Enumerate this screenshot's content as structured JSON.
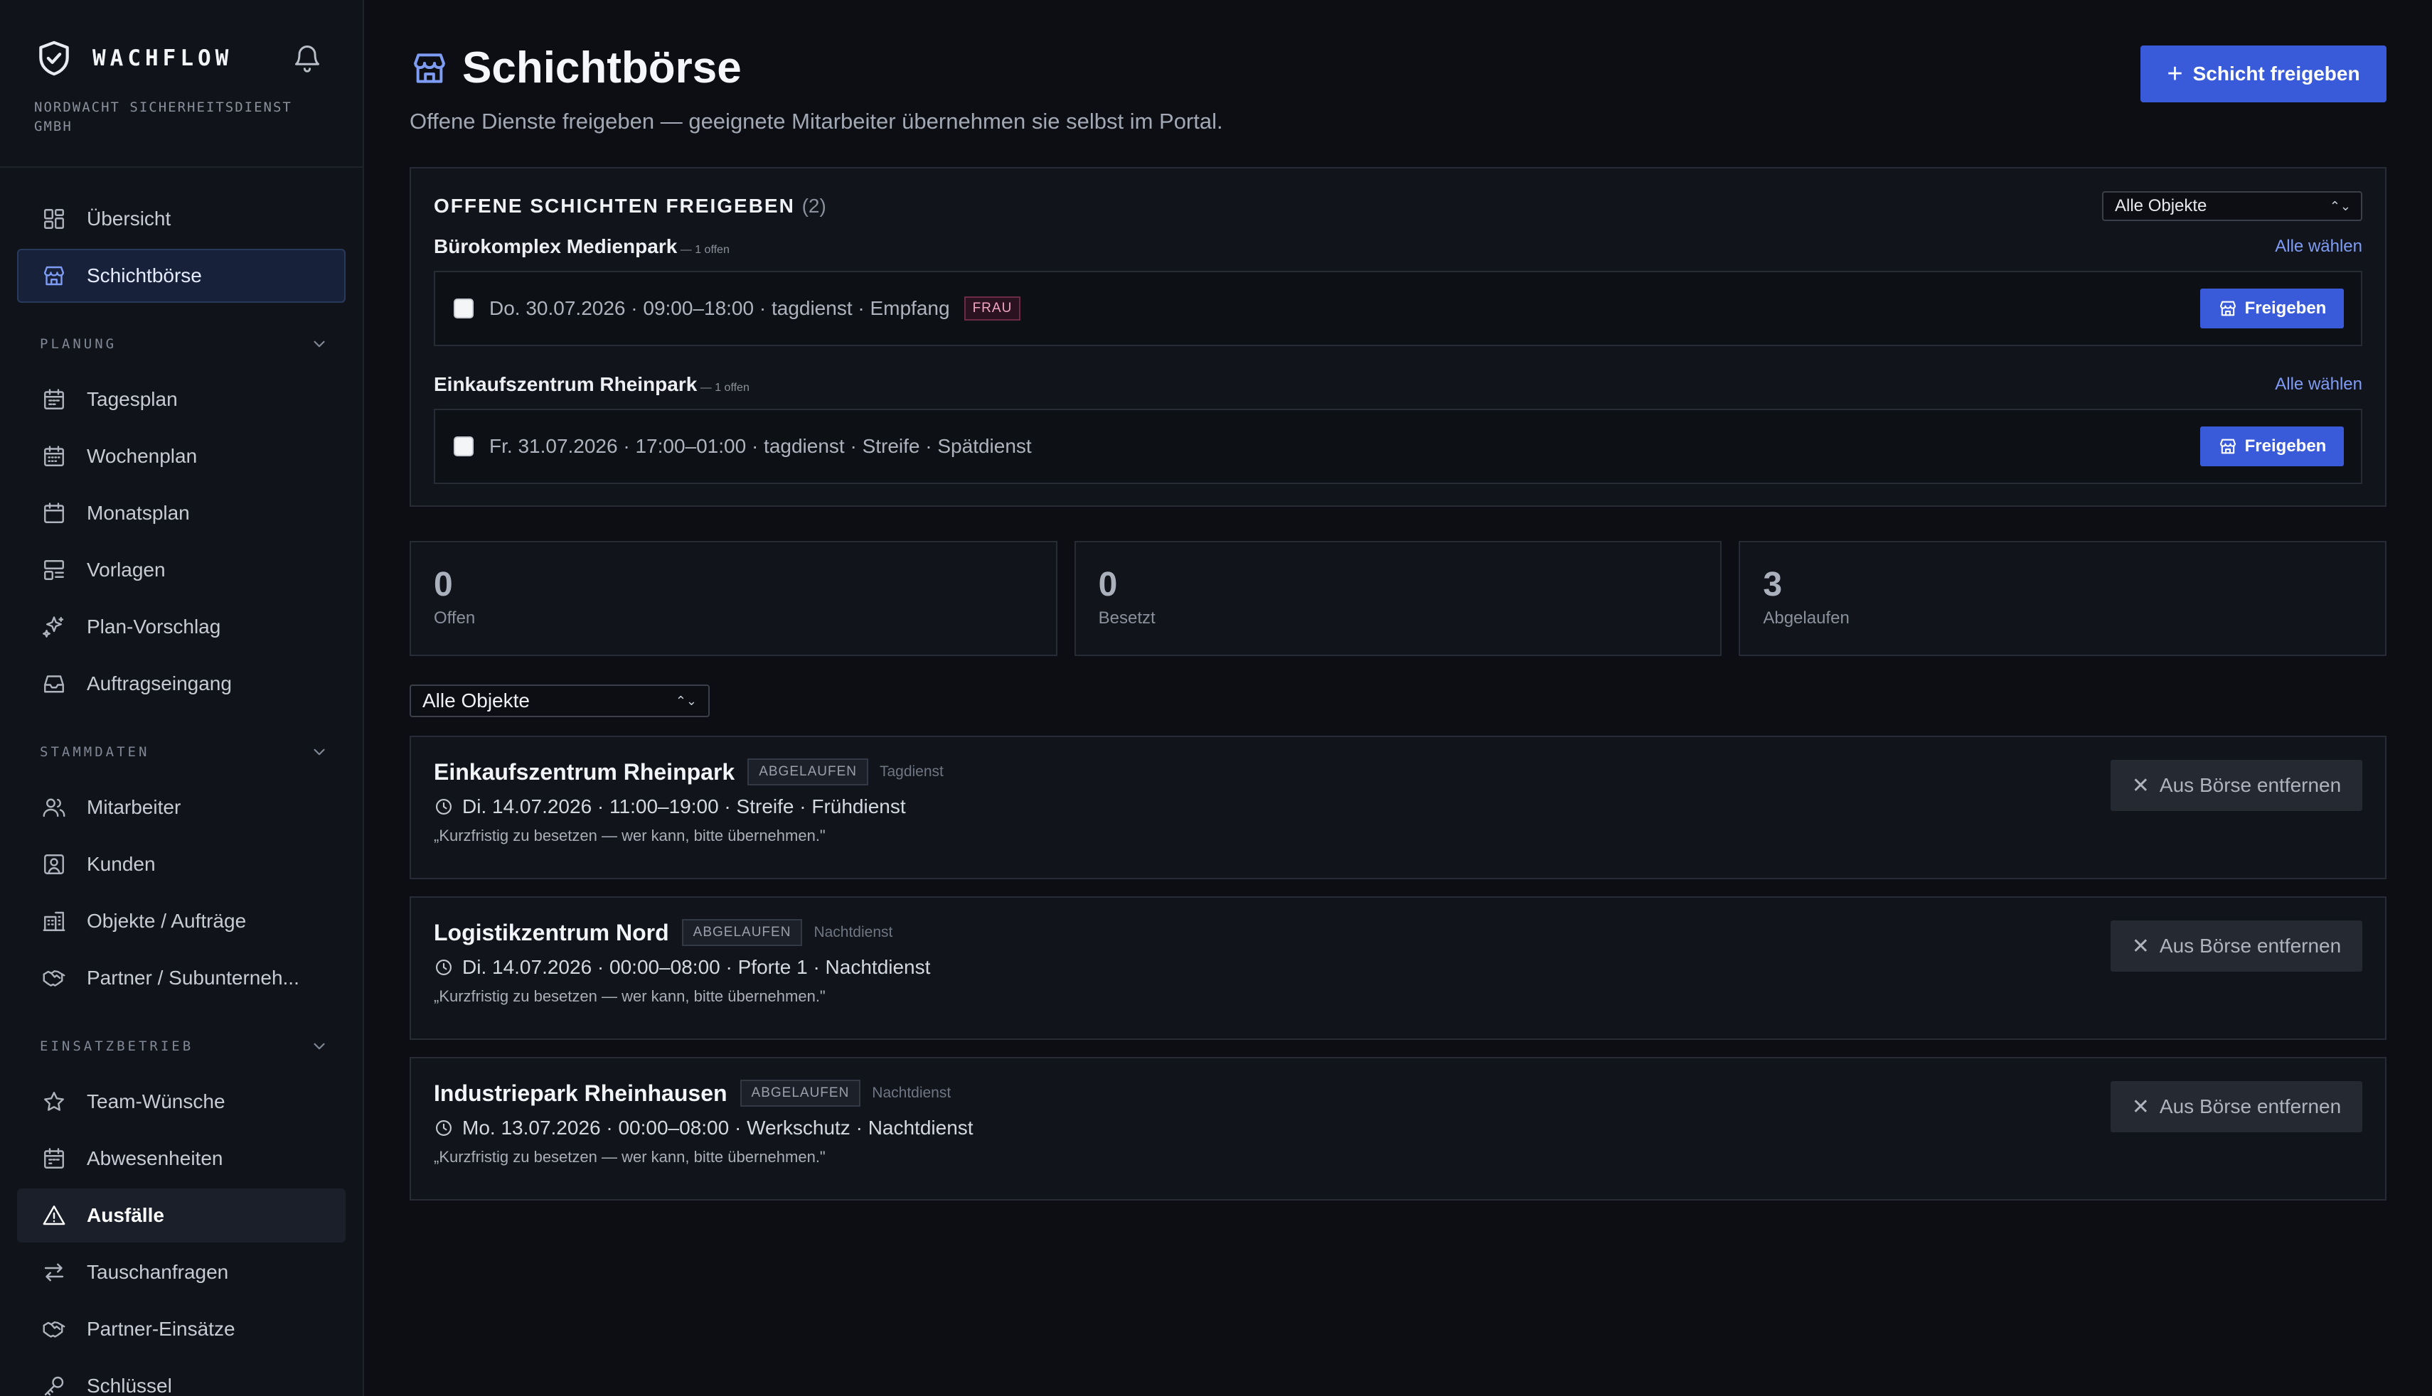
{
  "app": {
    "name": "WACHFLOW",
    "company": "NORDWACHT SICHERHEITSDIENST GMBH"
  },
  "sidebar": {
    "top_items": [
      {
        "label": "Übersicht",
        "icon": "dashboard-icon"
      },
      {
        "label": "Schichtbörse",
        "icon": "store-icon",
        "active": true
      }
    ],
    "sections": [
      {
        "title": "PLANUNG",
        "items": [
          {
            "label": "Tagesplan",
            "icon": "calendar-day-icon"
          },
          {
            "label": "Wochenplan",
            "icon": "calendar-week-icon"
          },
          {
            "label": "Monatsplan",
            "icon": "calendar-month-icon"
          },
          {
            "label": "Vorlagen",
            "icon": "template-icon"
          },
          {
            "label": "Plan-Vorschlag",
            "icon": "sparkles-icon"
          },
          {
            "label": "Auftragseingang",
            "icon": "inbox-icon"
          }
        ]
      },
      {
        "title": "STAMMDATEN",
        "items": [
          {
            "label": "Mitarbeiter",
            "icon": "users-icon"
          },
          {
            "label": "Kunden",
            "icon": "customer-icon"
          },
          {
            "label": "Objekte / Aufträge",
            "icon": "building-icon"
          },
          {
            "label": "Partner / Subunterneh...",
            "icon": "handshake-icon"
          }
        ]
      },
      {
        "title": "EINSATZBETRIEB",
        "items": [
          {
            "label": "Team-Wünsche",
            "icon": "star-icon"
          },
          {
            "label": "Abwesenheiten",
            "icon": "calendar-off-icon"
          },
          {
            "label": "Ausfälle",
            "icon": "warning-icon",
            "active": true
          },
          {
            "label": "Tauschanfragen",
            "icon": "swap-icon"
          },
          {
            "label": "Partner-Einsätze",
            "icon": "handshake-icon"
          },
          {
            "label": "Schlüssel",
            "icon": "key-icon"
          }
        ]
      }
    ]
  },
  "header": {
    "title": "Schichtbörse",
    "subtitle": "Offene Dienste freigeben — geeignete Mitarbeiter übernehmen sie selbst im Portal.",
    "primary_button": "Schicht freigeben"
  },
  "open_panel": {
    "title": "OFFENE SCHICHTEN FREIGEBEN",
    "count": "(2)",
    "filter": "Alle Objekte",
    "groups": [
      {
        "name": "Bürokomplex Medienpark",
        "count": "— 1 offen",
        "select_all": "Alle wählen",
        "shifts": [
          {
            "text": "Do. 30.07.2026 · 09:00–18:00 · tagdienst · Empfang",
            "tag": "FRAU",
            "button": "Freigeben"
          }
        ]
      },
      {
        "name": "Einkaufszentrum Rheinpark",
        "count": "— 1 offen",
        "select_all": "Alle wählen",
        "shifts": [
          {
            "text": "Fr. 31.07.2026 · 17:00–01:00 · tagdienst · Streife · Spätdienst",
            "tag": "",
            "button": "Freigeben"
          }
        ]
      }
    ]
  },
  "stats": [
    {
      "value": "0",
      "label": "Offen"
    },
    {
      "value": "0",
      "label": "Besetzt"
    },
    {
      "value": "3",
      "label": "Abgelaufen"
    }
  ],
  "filter": "Alle Objekte",
  "listings": [
    {
      "title": "Einkaufszentrum Rheinpark",
      "badge": "ABGELAUFEN",
      "type": "Tagdienst",
      "meta": "Di. 14.07.2026 · 11:00–19:00 · Streife · Frühdienst",
      "note": "„Kurzfristig zu besetzen — wer kann, bitte übernehmen.\"",
      "button": "Aus Börse entfernen"
    },
    {
      "title": "Logistikzentrum Nord",
      "badge": "ABGELAUFEN",
      "type": "Nachtdienst",
      "meta": "Di. 14.07.2026 · 00:00–08:00 · Pforte 1 · Nachtdienst",
      "note": "„Kurzfristig zu besetzen — wer kann, bitte übernehmen.\"",
      "button": "Aus Börse entfernen"
    },
    {
      "title": "Industriepark Rheinhausen",
      "badge": "ABGELAUFEN",
      "type": "Nachtdienst",
      "meta": "Mo. 13.07.2026 · 00:00–08:00 · Werkschutz · Nachtdienst",
      "note": "„Kurzfristig zu besetzen — wer kann, bitte übernehmen.\"",
      "button": "Aus Börse entfernen"
    }
  ],
  "colors": {
    "accent": "#3a5bd9",
    "background": "#0c0e13",
    "sidebar": "#101319",
    "link": "#7f9cf5"
  }
}
